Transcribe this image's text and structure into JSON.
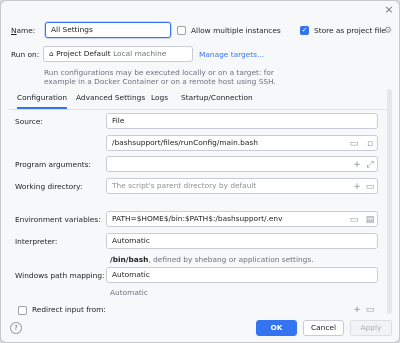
{
  "window": {
    "close_glyph": "×"
  },
  "name": {
    "label": "Name:",
    "mnemonic": "N",
    "rest": "ame:",
    "value": "All Settings"
  },
  "allow_multiple": {
    "label": "Allow multiple instances",
    "checked": false
  },
  "store_as_project": {
    "label": "Store as project file",
    "checked": true
  },
  "run_on": {
    "label": "Run on:",
    "target": "Project Default",
    "target_hint": "Local machine",
    "manage_link": "Manage targets...",
    "note_line1": "Run configurations may be executed locally or on a target: for",
    "note_line2": "example in a Docker Container or on a remote host using SSH."
  },
  "tabs": [
    {
      "label": "Configuration",
      "selected": true
    },
    {
      "label": "Advanced Settings",
      "selected": false
    },
    {
      "label": "Logs",
      "selected": false
    },
    {
      "label": "Startup/Connection",
      "selected": false
    }
  ],
  "source": {
    "label": "Source:",
    "value": "File",
    "file_path": "/bashsupport/files/runConfig/main.bash"
  },
  "program_arguments": {
    "label": "Program arguments:",
    "value": ""
  },
  "working_directory": {
    "label": "Working directory:",
    "placeholder": "The script's parent directory by default"
  },
  "env_vars": {
    "label": "Environment variables:",
    "value": "PATH=$HOME$/bin:$PATH$:/bashsupport/.env"
  },
  "interpreter": {
    "label": "Interpreter:",
    "value": "Automatic",
    "hint_bold": "/bin/bash",
    "hint_rest": ", defined by shebang or application settings."
  },
  "windows_path_mapping": {
    "label": "Windows path mapping:",
    "value": "Automatic",
    "hint": "Automatic"
  },
  "redirect_input": {
    "label": "Redirect input from:",
    "checked": false
  },
  "buttons": {
    "ok": "OK",
    "cancel": "Cancel",
    "apply": "Apply",
    "help": "?"
  },
  "icons": {
    "folder": "folder-icon",
    "expand": "expand-icon",
    "add": "add-icon",
    "settings": "gear-icon"
  }
}
